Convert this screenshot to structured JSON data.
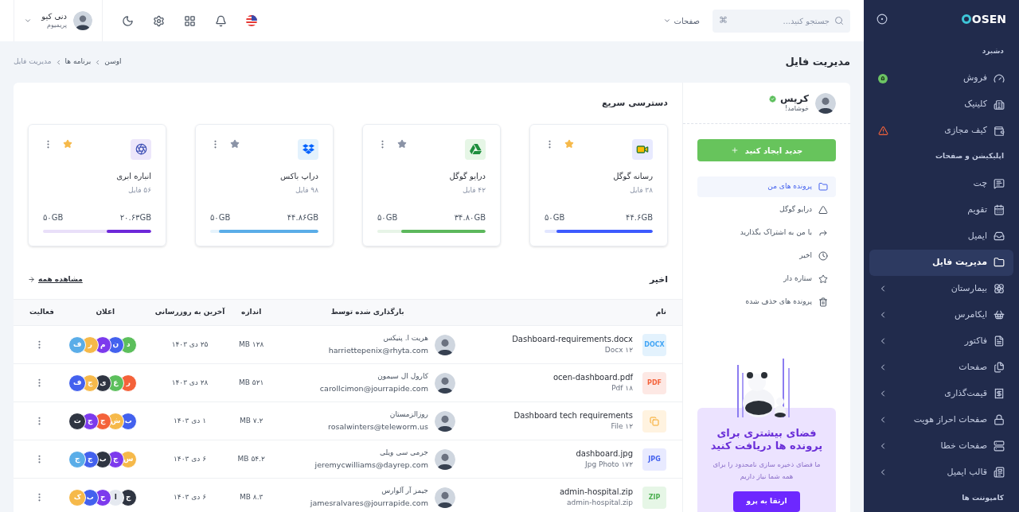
{
  "sidebar": {
    "logo": "OSEN",
    "items": [
      {
        "kind": "section",
        "label": "دشبرد"
      },
      {
        "kind": "item",
        "label": "فروش",
        "selected": false,
        "expandable": false,
        "badge": "۵"
      },
      {
        "kind": "item",
        "label": "کلینیک",
        "selected": false,
        "expandable": false
      },
      {
        "kind": "item",
        "label": "کیف مجازی",
        "selected": false,
        "expandable": false,
        "warning": true
      },
      {
        "kind": "section",
        "label": "اپلیکیشن و صفحات"
      },
      {
        "kind": "item",
        "label": "چت",
        "selected": false,
        "expandable": false
      },
      {
        "kind": "item",
        "label": "تقویم",
        "selected": false,
        "expandable": false
      },
      {
        "kind": "item",
        "label": "ایمیل",
        "selected": false,
        "expandable": false
      },
      {
        "kind": "item",
        "label": "مدیریت فایل",
        "selected": true,
        "expandable": false
      },
      {
        "kind": "item",
        "label": "بیمارستان",
        "selected": false,
        "expandable": true
      },
      {
        "kind": "item",
        "label": "ایکامرس",
        "selected": false,
        "expandable": true
      },
      {
        "kind": "item",
        "label": "فاکتور",
        "selected": false,
        "expandable": true
      },
      {
        "kind": "item",
        "label": "صفحات",
        "selected": false,
        "expandable": true
      },
      {
        "kind": "item",
        "label": "قیمت‌گذاری",
        "selected": false,
        "expandable": true
      },
      {
        "kind": "item",
        "label": "صفحات احراز هویت",
        "selected": false,
        "expandable": true
      },
      {
        "kind": "item",
        "label": "صفحات خطا",
        "selected": false,
        "expandable": true
      },
      {
        "kind": "item",
        "label": "قالب ایمیل",
        "selected": false,
        "expandable": true
      },
      {
        "kind": "section",
        "label": "کامپوننت ها"
      }
    ]
  },
  "header": {
    "search_placeholder": "جستجو کنید...",
    "search_shortcut": "⌘",
    "pages_menu": "صفحات",
    "user": {
      "name": "دنی کیو",
      "plan": "پریمیوم"
    }
  },
  "page": {
    "title": "مدیریت فایل",
    "breadcrumb": [
      "اوسن",
      "برنامه ها",
      "مدیریت فایل"
    ]
  },
  "profile": {
    "name": "کریس",
    "verified": true,
    "greeting": "خوشامد!"
  },
  "create_button": "جدید ایجاد کنید",
  "nav": [
    {
      "label": "پرونده های من",
      "selected": true
    },
    {
      "label": "درایو گوگل",
      "selected": false
    },
    {
      "label": "با من به اشتراک بگذارید",
      "selected": false
    },
    {
      "label": "اخیر",
      "selected": false
    },
    {
      "label": "ستاره دار",
      "selected": false
    },
    {
      "label": "پرونده های حذف شده",
      "selected": false
    }
  ],
  "promo": {
    "title": "فضای بیشتری برای پرونده ها دریافت کنید",
    "text": "ما فضای ذخیره سازی نامحدود را برای همه شما نیاز داریم",
    "button": "ارتقا به پرو"
  },
  "quick_access": {
    "title": "دسترسی سریع",
    "cards": [
      {
        "kind": "video",
        "name": "رسانه گوگل",
        "count": "۳۸ فایل",
        "used": "۴۴.۶GB",
        "total": "۵۰GB",
        "level": 0.89,
        "color": "#3d5afe",
        "starred": true
      },
      {
        "kind": "drive",
        "name": "درایو گوگل",
        "count": "۴۲ فایل",
        "used": "۳۴.۸۰GB",
        "total": "۵۰GB",
        "level": 0.78,
        "color": "#5cb85c",
        "starred": false
      },
      {
        "kind": "dropbox",
        "name": "دراپ باکس",
        "count": "۹۸ فایل",
        "used": "۴۴.۸۶GB",
        "total": "۵۰GB",
        "level": 0.92,
        "color": "#5aade8",
        "starred": false
      },
      {
        "kind": "aperture",
        "name": "انباره ابری",
        "count": "۵۶ فایل",
        "used": "۲۰.۶۳GB",
        "total": "۵۰GB",
        "level": 0.41,
        "color": "#6d28d9",
        "starred": true
      }
    ]
  },
  "recent": {
    "title": "اخیر",
    "view_all": "مشاهده همه",
    "columns": [
      "نام",
      "بارگذاری شده توسط",
      "اندازه",
      "آخرین به روزرسانی",
      "اعلان",
      "فعالیت"
    ],
    "rows": [
      {
        "file": "Dashboard-requirements.docx",
        "meta": "Docx ۱۲",
        "kind": "docx",
        "icon_label": "DOCX",
        "uploader": "هریت ا. پنیکس",
        "email": "harriettepenix@rhyta.com",
        "size": "MB ۱۲۸",
        "updated": "۲۵ دی ۱۴۰۳",
        "avatars": [
          {
            "letter": "د",
            "color": "#5cbf5c"
          },
          {
            "letter": "ن",
            "color": "#4361ee"
          },
          {
            "letter": "م",
            "color": "#7c3aed"
          },
          {
            "letter": "ر",
            "color": "#f6b94a"
          },
          {
            "letter": "ف",
            "color": "#5aade8"
          }
        ]
      },
      {
        "file": "ocen-dashboard.pdf",
        "meta": "Pdf ۱۸",
        "kind": "pdf",
        "icon_label": "PDF",
        "uploader": "کارول ال سیمون",
        "email": "carollcimon@jourrapide.com",
        "size": "MB ۵۲۱",
        "updated": "۲۸ دی ۱۴۰۳",
        "avatars": [
          {
            "letter": "ر",
            "color": "#f4623a"
          },
          {
            "letter": "ع",
            "color": "#5cbf5c"
          },
          {
            "letter": "ی",
            "color": "#2f3542"
          },
          {
            "letter": "ج",
            "color": "#f6b94a"
          },
          {
            "letter": "ف",
            "color": "#4361ee"
          }
        ]
      },
      {
        "file": "Dashboard tech requirements",
        "meta": "File ۱۲",
        "kind": "file",
        "uploader": "روزالزمستان",
        "email": "rosalwinters@teleworm.us",
        "size": "MB ۷.۲",
        "updated": "۱ دی ۱۴۰۳",
        "avatars": [
          {
            "letter": "ب",
            "color": "#4361ee"
          },
          {
            "letter": "ش",
            "color": "#f6b94a"
          },
          {
            "letter": "ج",
            "color": "#f4623a"
          },
          {
            "letter": "ج",
            "color": "#7c3aed"
          },
          {
            "letter": "ت",
            "color": "#2f3542"
          }
        ]
      },
      {
        "file": "dashboard.jpg",
        "meta": "Jpg Photo ۱۷۲",
        "kind": "jpg",
        "icon_label": "JPG",
        "uploader": "جرمی سی ویلی",
        "email": "jeremycwilliams@dayrep.com",
        "size": "MB ۵۴.۲",
        "updated": "۶ دی ۱۴۰۳",
        "avatars": [
          {
            "letter": "س",
            "color": "#f6b94a"
          },
          {
            "letter": "ج",
            "color": "#7c3aed"
          },
          {
            "letter": "ب",
            "color": "#2f3542"
          },
          {
            "letter": "ج",
            "color": "#4361ee"
          },
          {
            "letter": "ج",
            "color": "#5aade8"
          }
        ]
      },
      {
        "file": "admin-hospital.zip",
        "meta": "admin-hospital.zip",
        "kind": "zip",
        "icon_label": "ZIP",
        "uploader": "جیمز آر آلوارس",
        "email": "jamesralvares@jourrapide.com",
        "size": "MB ۸.۳",
        "updated": "۶ دی ۱۴۰۳",
        "avatars": [
          {
            "letter": "ج",
            "color": "#2f3542"
          },
          {
            "letter": "ا",
            "color": "#e5e9f0"
          },
          {
            "letter": "ح",
            "color": "#7c3aed"
          },
          {
            "letter": "ب",
            "color": "#4361ee"
          },
          {
            "letter": "ک",
            "color": "#f6b94a"
          }
        ]
      }
    ]
  }
}
